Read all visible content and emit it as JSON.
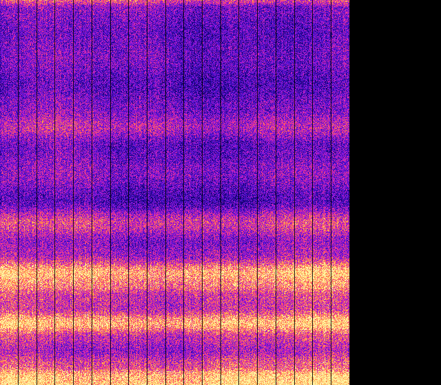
{
  "image": {
    "kind": "spectrogram-heatmap",
    "colormap": "plasma-like",
    "colors": {
      "background": "#000000",
      "low": "#12006b",
      "mid_low": "#4b12d6",
      "mid": "#b21ad0",
      "mid_high": "#ff3f7a",
      "high": "#ff9b3d",
      "peak": "#fff2a0",
      "grid_line": "#000000"
    },
    "vertical_grid_lines": 19,
    "energy_profile": [
      {
        "pos": 0.0,
        "level": 0.62
      },
      {
        "pos": 0.02,
        "level": 0.35
      },
      {
        "pos": 0.08,
        "level": 0.28
      },
      {
        "pos": 0.15,
        "level": 0.32
      },
      {
        "pos": 0.22,
        "level": 0.24
      },
      {
        "pos": 0.28,
        "level": 0.34
      },
      {
        "pos": 0.33,
        "level": 0.5
      },
      {
        "pos": 0.38,
        "level": 0.28
      },
      {
        "pos": 0.45,
        "level": 0.38
      },
      {
        "pos": 0.52,
        "level": 0.22
      },
      {
        "pos": 0.58,
        "level": 0.6
      },
      {
        "pos": 0.63,
        "level": 0.38
      },
      {
        "pos": 0.66,
        "level": 0.44
      },
      {
        "pos": 0.71,
        "level": 0.9
      },
      {
        "pos": 0.74,
        "level": 0.78
      },
      {
        "pos": 0.77,
        "level": 0.58
      },
      {
        "pos": 0.8,
        "level": 0.55
      },
      {
        "pos": 0.84,
        "level": 0.92
      },
      {
        "pos": 0.88,
        "level": 0.55
      },
      {
        "pos": 0.91,
        "level": 0.45
      },
      {
        "pos": 0.95,
        "level": 0.65
      },
      {
        "pos": 0.98,
        "level": 0.95
      },
      {
        "pos": 1.0,
        "level": 0.98
      }
    ]
  }
}
